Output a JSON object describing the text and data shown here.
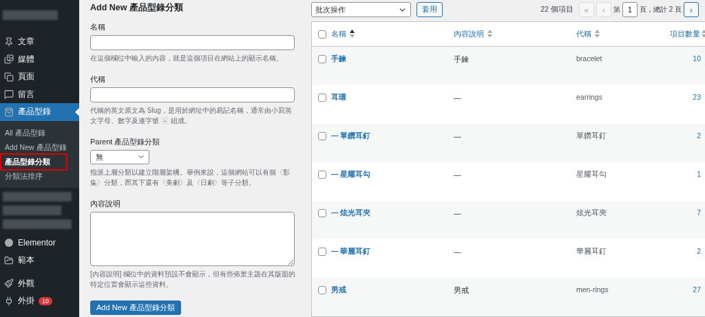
{
  "sidebar": {
    "items": [
      {
        "label": "文章",
        "selected": false
      },
      {
        "label": "媒體",
        "selected": false
      },
      {
        "label": "頁面",
        "selected": false
      },
      {
        "label": "留言",
        "selected": false
      },
      {
        "label": "產品型錄",
        "selected": true,
        "children": [
          {
            "label": "All 產品型錄",
            "selected": false
          },
          {
            "label": "Add New 產品型錄",
            "selected": false
          },
          {
            "label": "產品型錄分類",
            "selected": true
          },
          {
            "label": "分類法排序",
            "selected": false
          }
        ]
      },
      {
        "kind": "redacted"
      },
      {
        "kind": "redacted"
      },
      {
        "kind": "redacted"
      },
      {
        "label": "Elementor",
        "selected": false
      },
      {
        "label": "範本",
        "selected": false
      },
      {
        "label": "外觀",
        "selected": false
      },
      {
        "label": "外掛",
        "selected": false,
        "badge": "10"
      }
    ]
  },
  "form": {
    "title": "Add New 產品型錄分類",
    "fields": [
      {
        "kind": "text",
        "label": "名稱",
        "hint": "在這個欄位中輸入的內容，就是這個項目在網站上的顯示名稱。"
      },
      {
        "kind": "text",
        "label": "代稱",
        "hint": "代稱的英文原文為 Slug，是用於網址中的易記名稱，通常由小寫英文字母、數字及連字號",
        "code": "-",
        "hint_after": "組成。"
      },
      {
        "kind": "select",
        "label": "Parent 產品型錄分類",
        "value": "無",
        "hint": "指派上層分類以建立階層架構。舉例來說，這個網站可以有個〈影集〉分類，而其下還有〈美劇〉及〈日劇〉等子分類。"
      },
      {
        "kind": "textarea",
        "label": "內容說明",
        "hint": "[內容說明] 欄位中的資料預設不會顯示，但有些佈景主題在其版面的特定位置會顯示這些資料。"
      }
    ],
    "submit": "Add New 產品型錄分類"
  },
  "toolbar": {
    "bulk_action": "批次操作",
    "apply": "套用",
    "count": "22 個項目",
    "pager": [
      {
        "kind": "button",
        "label": "«",
        "disabled": true
      },
      {
        "kind": "button",
        "label": "‹",
        "disabled": true
      },
      {
        "kind": "text",
        "label": "第"
      },
      {
        "kind": "input",
        "label": "1"
      },
      {
        "kind": "text",
        "label": "頁，總計 2 頁"
      },
      {
        "kind": "button",
        "label": "›",
        "disabled": false
      }
    ]
  },
  "table": {
    "select_all": {
      "checked": false
    },
    "columns": [
      {
        "label": "名稱",
        "sorted": true
      },
      {
        "label": "內容說明",
        "sorted": false
      },
      {
        "label": "代稱",
        "sorted": false
      },
      {
        "label": "項目數量",
        "sorted": false
      }
    ],
    "rows": [
      {
        "name": "手鍊",
        "description": "手鍊",
        "slug": "bracelet",
        "count": "10",
        "checked": false
      },
      {
        "name": "耳環",
        "description": "—",
        "slug": "earrings",
        "count": "23",
        "checked": false,
        "children": [
          {
            "name": "— 單鑽耳釘",
            "description": "—",
            "slug": "單鑽耳釘",
            "count": "2",
            "checked": false
          },
          {
            "name": "— 星耀耳勾",
            "description": "—",
            "slug": "星耀耳勾",
            "count": "1",
            "checked": false
          },
          {
            "name": "— 炫光耳夾",
            "description": "—",
            "slug": "炫光耳夾",
            "count": "7",
            "checked": false
          },
          {
            "name": "— 華麗耳釘",
            "description": "—",
            "slug": "華麗耳釘",
            "count": "2",
            "checked": false
          }
        ]
      },
      {
        "name": "男戒",
        "description": "男戒",
        "slug": "men-rings",
        "count": "27",
        "checked": false
      }
    ]
  }
}
